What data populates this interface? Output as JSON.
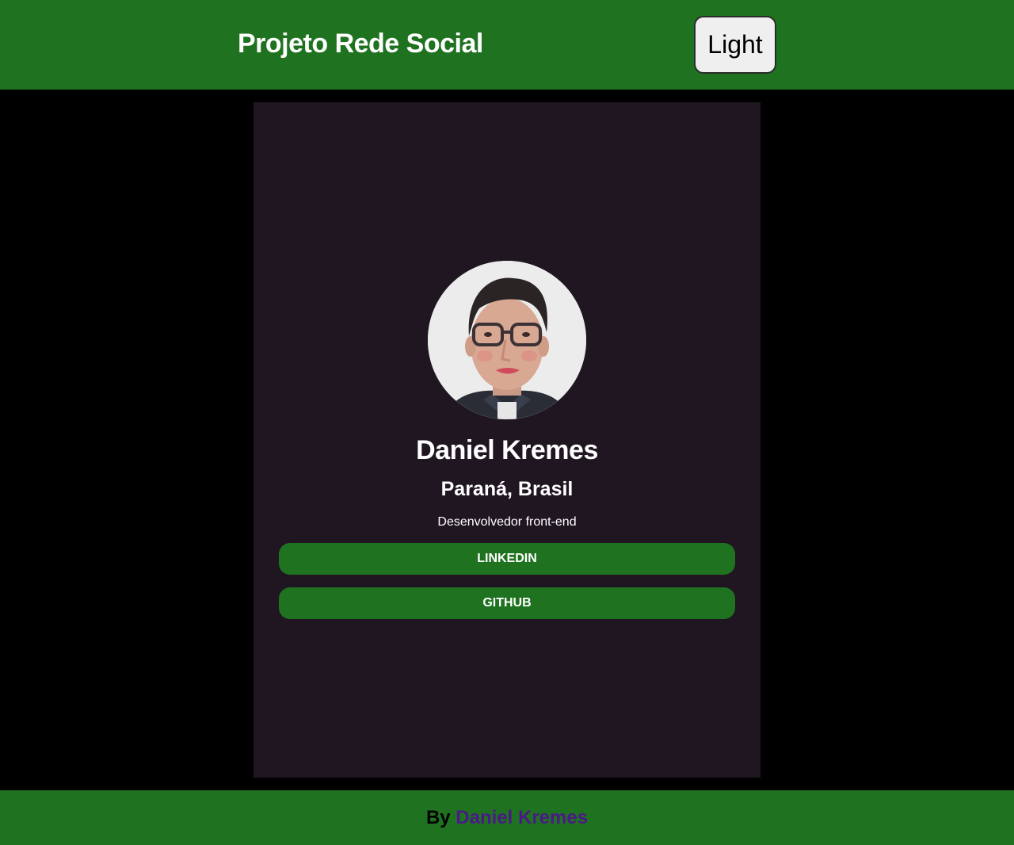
{
  "header": {
    "title": "Projeto Rede Social",
    "theme_button_label": "Light"
  },
  "profile": {
    "name": "Daniel Kremes",
    "location": "Paraná, Brasil",
    "role": "Desenvolvedor front-end",
    "avatar_icon": "profile-photo"
  },
  "links": {
    "linkedin_label": "LINKEDIN",
    "github_label": "GITHUB"
  },
  "footer": {
    "by_label": "By",
    "author_link": "Daniel Kremes"
  },
  "colors": {
    "header_bg": "#1f721f",
    "page_bg": "#000000",
    "card_bg": "#201622",
    "button_bg": "#1f721f",
    "footer_link": "#4a1a86"
  }
}
